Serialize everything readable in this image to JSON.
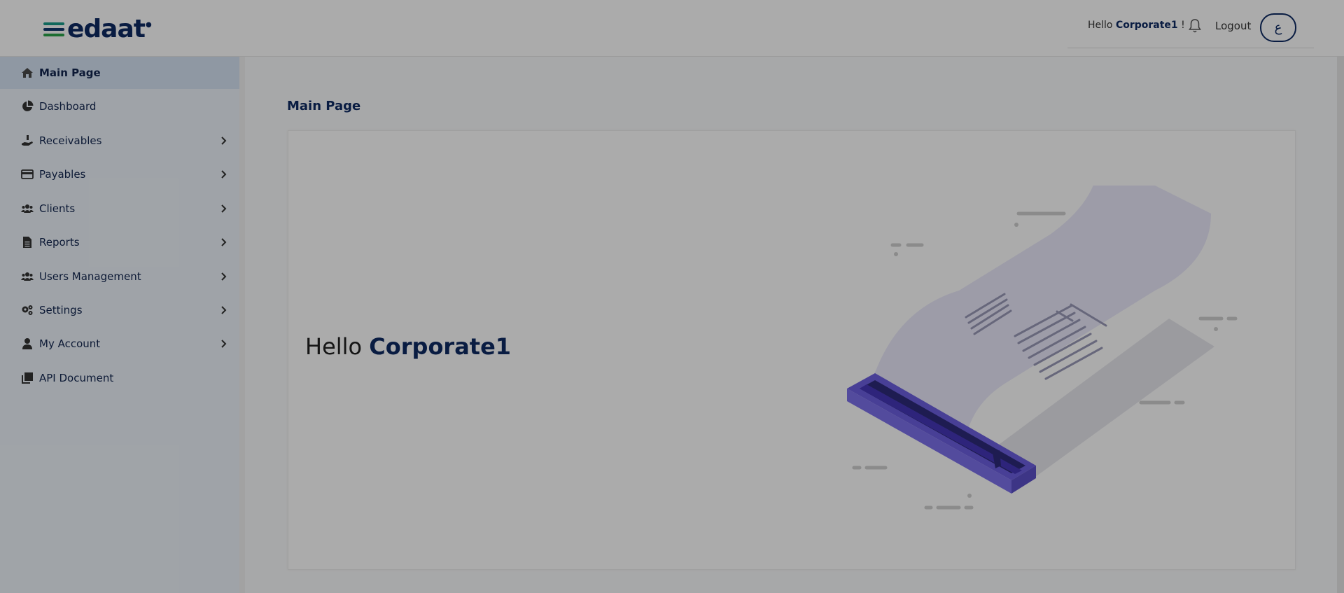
{
  "header": {
    "logo_text": "edaat",
    "greeting_prefix": "Hello",
    "username": "Corporate1",
    "greeting_suffix": "!",
    "logout_label": "Logout",
    "language_button": "ع"
  },
  "sidebar": {
    "items": [
      {
        "label": "Main Page",
        "icon": "home-icon",
        "active": true,
        "has_submenu": false
      },
      {
        "label": "Dashboard",
        "icon": "pie-chart-icon",
        "active": false,
        "has_submenu": false
      },
      {
        "label": "Receivables",
        "icon": "hand-coin-icon",
        "active": false,
        "has_submenu": true
      },
      {
        "label": "Payables",
        "icon": "credit-card-icon",
        "active": false,
        "has_submenu": true
      },
      {
        "label": "Clients",
        "icon": "users-icon",
        "active": false,
        "has_submenu": true
      },
      {
        "label": "Reports",
        "icon": "file-icon",
        "active": false,
        "has_submenu": true
      },
      {
        "label": "Users Management",
        "icon": "users-group-icon",
        "active": false,
        "has_submenu": true
      },
      {
        "label": "Settings",
        "icon": "gears-icon",
        "active": false,
        "has_submenu": true
      },
      {
        "label": "My Account",
        "icon": "user-icon",
        "active": false,
        "has_submenu": true
      },
      {
        "label": "API Document",
        "icon": "copy-icon",
        "active": false,
        "has_submenu": false
      }
    ]
  },
  "main": {
    "page_title": "Main Page",
    "hello_prefix": "Hello",
    "hello_name": "Corporate1"
  },
  "colors": {
    "brand": "#0e2a63",
    "sidebar_bg": "#eef4fb",
    "sidebar_active": "#d6e3f3",
    "illustration": "#6c5fe0"
  }
}
